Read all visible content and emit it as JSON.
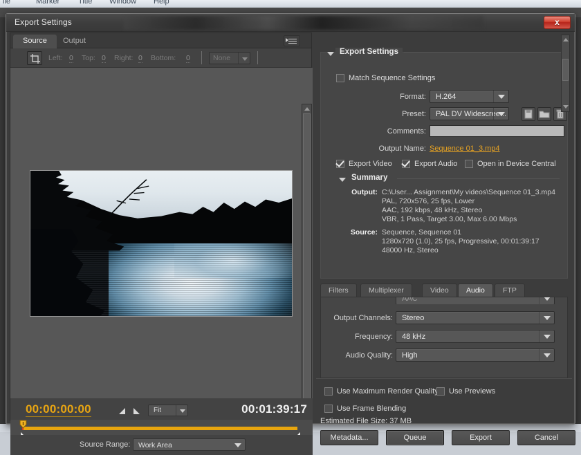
{
  "host": {
    "menu_items": [
      "ile",
      "Marker",
      "Title",
      "Window",
      "Help"
    ]
  },
  "window": {
    "title": "Export Settings",
    "close_label": "x"
  },
  "source_panel": {
    "tabs": [
      {
        "label": "Source",
        "active": true
      },
      {
        "label": "Output",
        "active": false
      }
    ],
    "crop_toolbar": {
      "left_label": "Left:",
      "left_value": "0",
      "top_label": "Top:",
      "top_value": "0",
      "right_label": "Right:",
      "right_value": "0",
      "bottom_label": "Bottom:",
      "bottom_value": "0",
      "aspect_select": "None"
    },
    "playback": {
      "current_timecode": "00:00:00:00",
      "duration_timecode": "00:01:39:17",
      "zoom_level": "Fit"
    },
    "source_range": {
      "label": "Source Range:",
      "value": "Work Area"
    }
  },
  "export_settings": {
    "group_title": "Export Settings",
    "match_sequence": {
      "label": "Match Sequence Settings",
      "checked": false
    },
    "format": {
      "label": "Format:",
      "value": "H.264"
    },
    "preset": {
      "label": "Preset:",
      "value": "PAL DV Widescree..."
    },
    "comments": {
      "label": "Comments:",
      "value": ""
    },
    "output_name": {
      "label": "Output Name:",
      "value": "Sequence 01_3.mp4"
    },
    "export_video": {
      "label": "Export Video",
      "checked": true
    },
    "export_audio": {
      "label": "Export Audio",
      "checked": true
    },
    "open_device_central": {
      "label": "Open in Device Central",
      "checked": false
    },
    "summary": {
      "title": "Summary",
      "output_key": "Output:",
      "output_lines": [
        "C:\\User... Assignment\\My videos\\Sequence 01_3.mp4",
        "PAL, 720x576, 25 fps, Lower",
        "AAC, 192 kbps, 48 kHz, Stereo",
        "VBR, 1 Pass, Target 3.00, Max 6.00 Mbps"
      ],
      "source_key": "Source:",
      "source_lines": [
        "Sequence, Sequence 01",
        "1280x720 (1.0), 25 fps, Progressive, 00:01:39:17",
        "48000 Hz, Stereo"
      ]
    }
  },
  "codec_tabs": [
    {
      "label": "Filters",
      "active": false
    },
    {
      "label": "Multiplexer",
      "active": false
    },
    {
      "label": "Video",
      "active": false
    },
    {
      "label": "Audio",
      "active": true
    },
    {
      "label": "FTP",
      "active": false
    }
  ],
  "audio_panel": {
    "output_channels": {
      "label": "Output Channels:",
      "value": "Stereo"
    },
    "frequency": {
      "label": "Frequency:",
      "value": "48 kHz"
    },
    "audio_quality": {
      "label": "Audio Quality:",
      "value": "High"
    }
  },
  "bottom_options": {
    "max_render_quality": {
      "label": "Use Maximum Render Quality",
      "checked": false
    },
    "use_previews": {
      "label": "Use Previews",
      "checked": false
    },
    "frame_blending": {
      "label": "Use Frame Blending",
      "checked": false
    },
    "estimated_file_size": "Estimated File Size: 37 MB"
  },
  "buttons": {
    "metadata": "Metadata...",
    "queue": "Queue",
    "export": "Export",
    "cancel": "Cancel"
  },
  "colors": {
    "accent_orange": "#e9a60e",
    "link_orange": "#e7a323",
    "panel_bg": "#464646",
    "window_bg": "#3c3c3c",
    "close_red": "#cf3e2d"
  }
}
